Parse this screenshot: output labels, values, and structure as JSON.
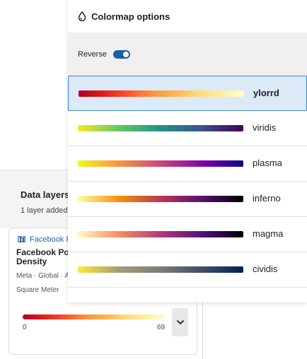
{
  "popover": {
    "title": "Colormap options",
    "icon": "droplet-icon",
    "reverse_label": "Reverse",
    "reverse_on": true
  },
  "colormaps": [
    {
      "name": "ylorrd",
      "selected": true,
      "stops": [
        "#b10026",
        "#e31a1c",
        "#fc4e2a",
        "#fd8d3c",
        "#feb24c",
        "#fed976",
        "#ffeda0",
        "#ffffcc"
      ]
    },
    {
      "name": "viridis",
      "selected": false,
      "stops": [
        "#fde725",
        "#5ec962",
        "#21918c",
        "#3b528b",
        "#440154"
      ]
    },
    {
      "name": "plasma",
      "selected": false,
      "stops": [
        "#f0f921",
        "#fca636",
        "#e16462",
        "#b12a90",
        "#6a00a8",
        "#0d0887"
      ]
    },
    {
      "name": "inferno",
      "selected": false,
      "stops": [
        "#fcffa4",
        "#f98e09",
        "#bc3754",
        "#57106e",
        "#000004"
      ]
    },
    {
      "name": "magma",
      "selected": false,
      "stops": [
        "#fcfdbf",
        "#fc8961",
        "#b73779",
        "#51127c",
        "#000004"
      ]
    },
    {
      "name": "cividis",
      "selected": false,
      "stops": [
        "#fee838",
        "#a59c74",
        "#7c7b78",
        "#414d6b",
        "#00224e"
      ]
    }
  ],
  "data_layers": {
    "title": "Data layers",
    "subtitle": "1 layer added"
  },
  "layer_card": {
    "source": "Facebook P",
    "source_icon": "meta-icon",
    "title": "Facebook Po Density",
    "meta": "Meta · Global · A Square Meter",
    "legend_min": "0",
    "legend_max": "69",
    "legend_stops": [
      "#b10026",
      "#e31a1c",
      "#fc4e2a",
      "#fd8d3c",
      "#feb24c",
      "#fed976",
      "#ffeda0",
      "#ffffcc"
    ]
  },
  "colors": {
    "accent": "#1a5fa8",
    "selected_bg": "#dce9f7",
    "selected_border": "#3c82c8"
  }
}
